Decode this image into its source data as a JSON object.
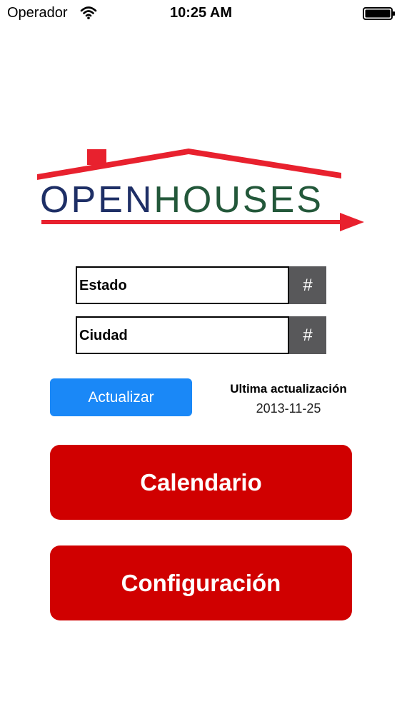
{
  "status_bar": {
    "carrier": "Operador",
    "time": "10:25 AM"
  },
  "logo": {
    "word_1": "OPEN",
    "word_2": "HOUSES",
    "color_word_1": "#1e2f66",
    "color_word_2": "#23583a",
    "color_roof": "#e8212e"
  },
  "form": {
    "state_label": "Estado",
    "state_button": "#",
    "city_label": "Ciudad",
    "city_button": "#"
  },
  "update": {
    "button_label": "Actualizar",
    "last_update_title": "Ultima actualización",
    "last_update_date": "2013-11-25",
    "accent": "#1a88f7"
  },
  "actions": {
    "calendar_label": "Calendario",
    "config_label": "Configuración",
    "color": "#d00000"
  }
}
